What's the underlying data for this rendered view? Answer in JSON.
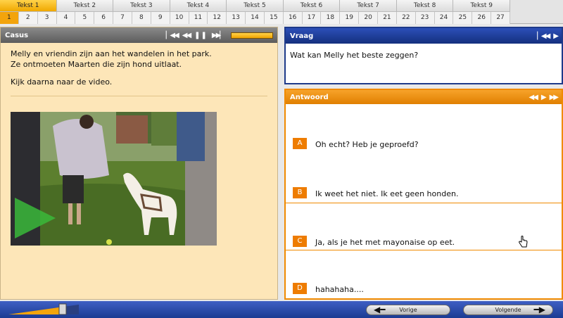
{
  "topnav": {
    "groups": [
      {
        "label": "Tekst 1",
        "pages": [
          "1",
          "2",
          "3"
        ],
        "active": true
      },
      {
        "label": "Tekst 2",
        "pages": [
          "4",
          "5",
          "6"
        ]
      },
      {
        "label": "Tekst 3",
        "pages": [
          "7",
          "8",
          "9"
        ]
      },
      {
        "label": "Tekst 4",
        "pages": [
          "10",
          "11",
          "12"
        ]
      },
      {
        "label": "Tekst 5",
        "pages": [
          "13",
          "14",
          "15"
        ]
      },
      {
        "label": "Tekst 6",
        "pages": [
          "16",
          "17",
          "18"
        ]
      },
      {
        "label": "Tekst 7",
        "pages": [
          "19",
          "20",
          "21"
        ]
      },
      {
        "label": "Tekst 8",
        "pages": [
          "22",
          "23",
          "24"
        ]
      },
      {
        "label": "Tekst 9",
        "pages": [
          "25",
          "26",
          "27"
        ]
      }
    ],
    "active_page": "1"
  },
  "casus": {
    "title": "Casus",
    "progress": 1.0,
    "lines": [
      "Melly en vriendin zijn aan het wandelen in het park.",
      "Ze ontmoeten Maarten die zijn hond uitlaat."
    ],
    "instruction": "Kijk daarna naar de video."
  },
  "vraag": {
    "title": "Vraag",
    "question": "Wat kan Melly het beste zeggen?"
  },
  "antwoord": {
    "title": "Antwoord",
    "options": [
      {
        "letter": "A",
        "text": "Oh echt? Heb je geproefd?"
      },
      {
        "letter": "B",
        "text": "Ik weet het niet. Ik eet geen honden."
      },
      {
        "letter": "C",
        "text": "Ja, als je het met mayonaise op eet."
      },
      {
        "letter": "D",
        "text": "hahahaha...."
      }
    ],
    "selected": "C"
  },
  "footer": {
    "volume": 0.72,
    "prev_label": "Vorige",
    "next_label": "Volgende"
  },
  "colors": {
    "accent_orange": "#f08a00",
    "nav_blue": "#1e3a8a",
    "casus_bg": "#fde6b8"
  }
}
